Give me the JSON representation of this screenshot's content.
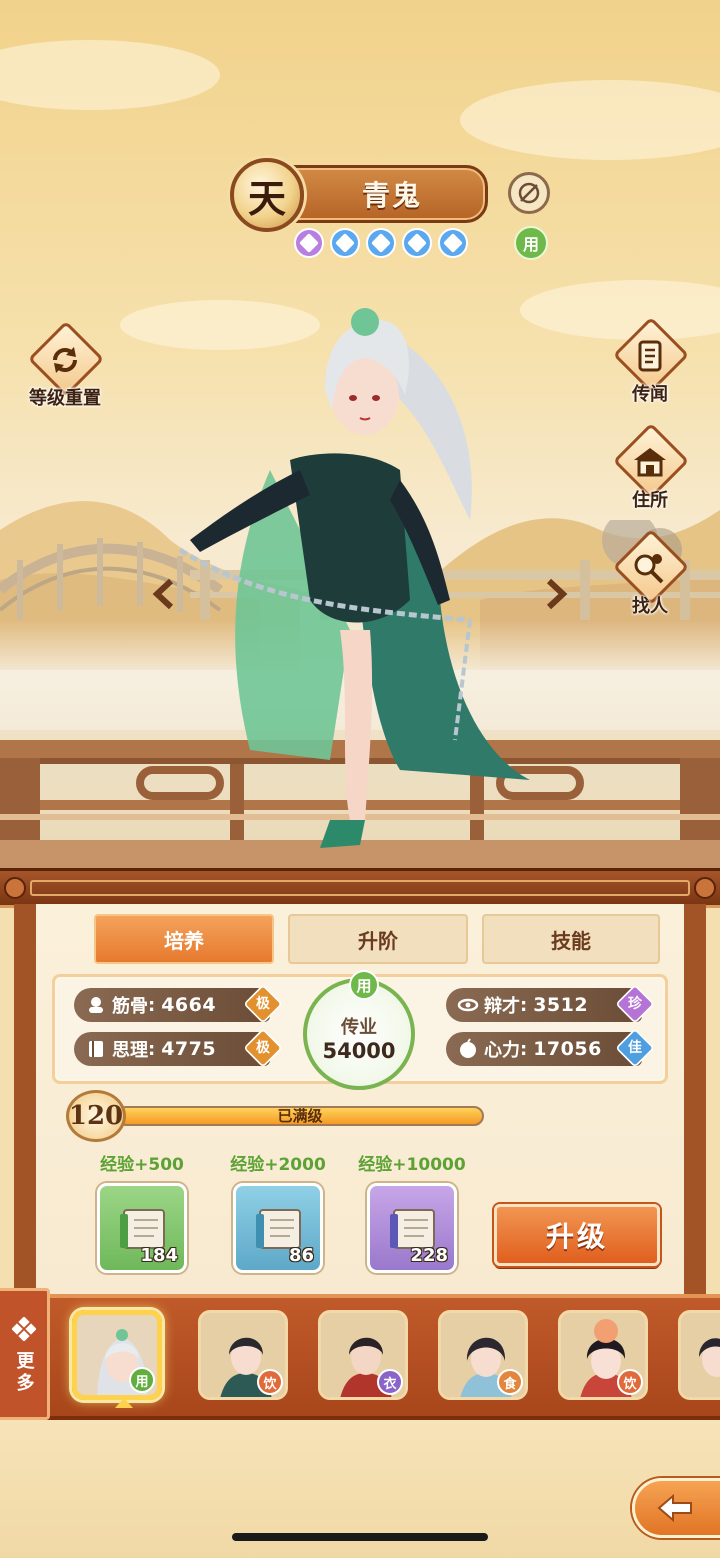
{
  "character": {
    "rank": "天",
    "name": "青鬼",
    "star_count": 5,
    "status_chip": "用"
  },
  "side_buttons": {
    "reset_level": "等级重置",
    "legend": "传闻",
    "residence": "住所",
    "find_person": "找人"
  },
  "tabs": [
    {
      "label": "培养",
      "active": true
    },
    {
      "label": "升阶",
      "active": false
    },
    {
      "label": "技能",
      "active": false
    }
  ],
  "stats": {
    "jingu": {
      "name": "筋骨",
      "value": "4664",
      "grade": "极",
      "grade_color": "#e3912f"
    },
    "sili": {
      "name": "思理",
      "value": "4775",
      "grade": "极",
      "grade_color": "#e3912f"
    },
    "biancai": {
      "name": "辩才",
      "value": "3512",
      "grade": "珍",
      "grade_color": "#b673d6"
    },
    "xinli": {
      "name": "心力",
      "value": "17056",
      "grade": "佳",
      "grade_color": "#4f9fe0"
    }
  },
  "center_seal": {
    "chip": "用",
    "label": "传业",
    "value": "54000"
  },
  "level": {
    "number": "120",
    "status": "已满级",
    "progress": 1.0
  },
  "exp_books": [
    {
      "label": "经验+500",
      "count": "184",
      "color": "#7cc36a"
    },
    {
      "label": "经验+2000",
      "count": "86",
      "color": "#6ab8d6"
    },
    {
      "label": "经验+10000",
      "count": "228",
      "color": "#b28ad8"
    }
  ],
  "upgrade_label": "升级",
  "more_label": "更多",
  "roster": [
    {
      "tag": "用",
      "tag_color": "#5fae3e",
      "selected": true
    },
    {
      "tag": "饮",
      "tag_color": "#e06a3a",
      "selected": false
    },
    {
      "tag": "衣",
      "tag_color": "#8a64c8",
      "selected": false
    },
    {
      "tag": "食",
      "tag_color": "#e3853a",
      "selected": false
    },
    {
      "tag": "饮",
      "tag_color": "#e06a3a",
      "selected": false
    }
  ],
  "colors": {
    "accent_orange": "#e67a2e",
    "panel_brown": "#a35427",
    "stat_bar": "#6b4c36",
    "seal_green": "#79b451"
  }
}
